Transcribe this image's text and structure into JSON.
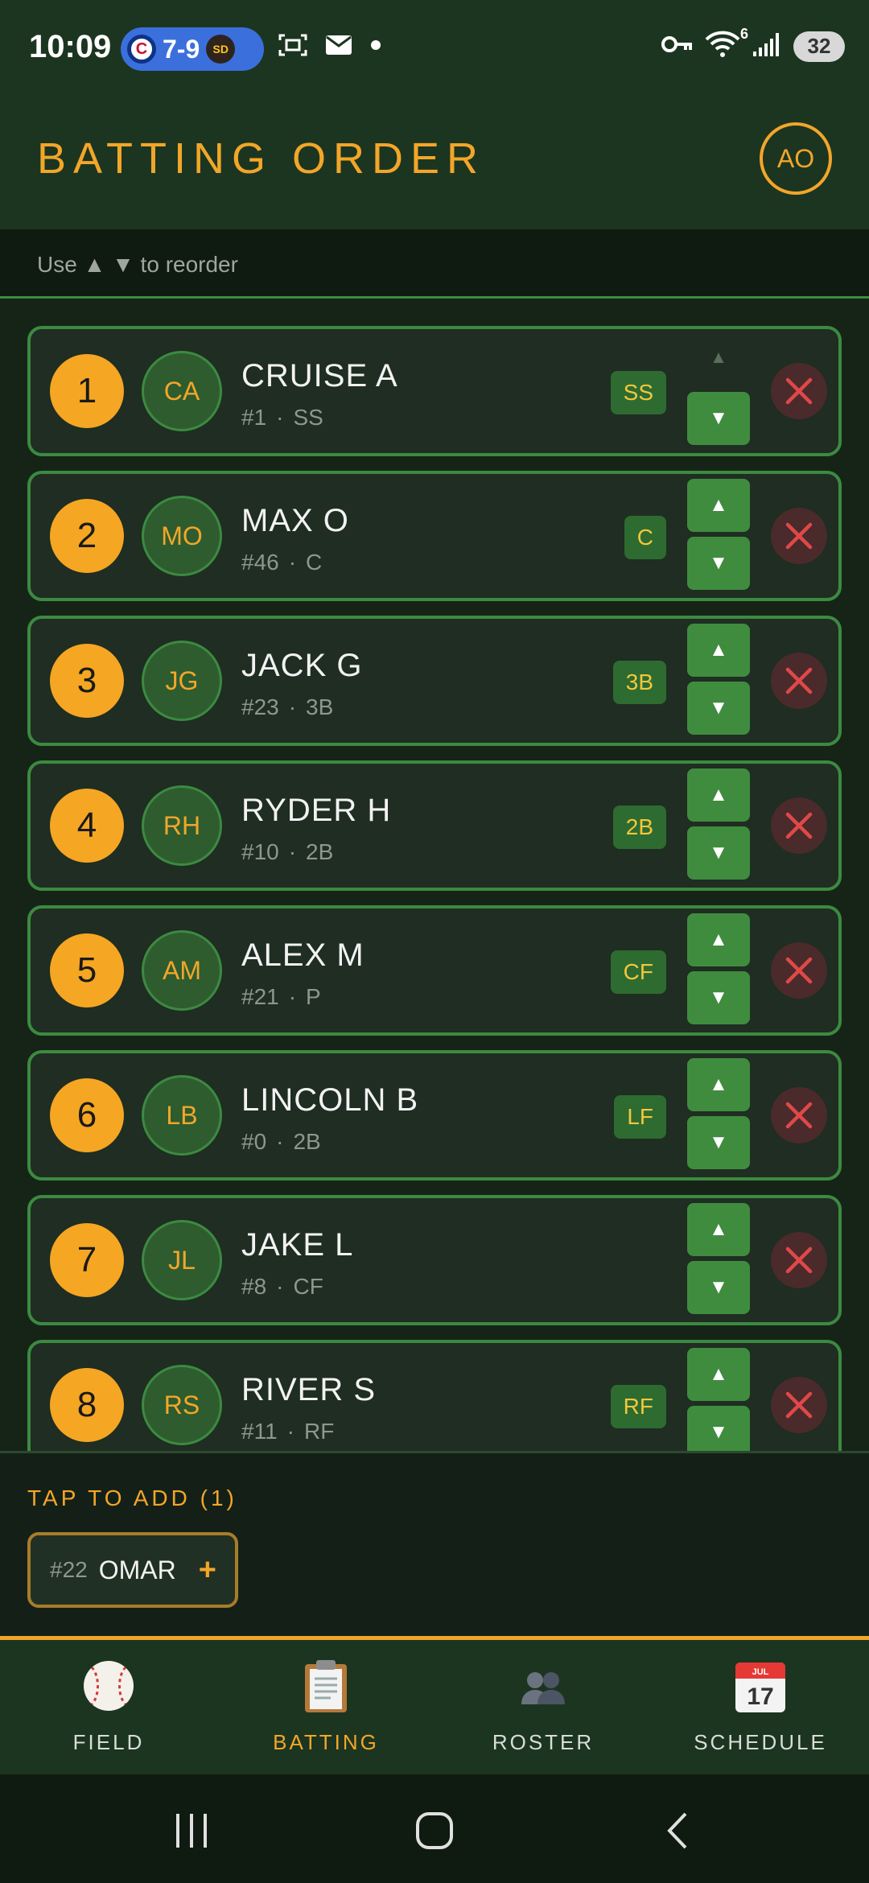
{
  "status_bar": {
    "time": "10:09",
    "score": "7-9",
    "away_team_badge": "C",
    "home_team_badge": "SD",
    "battery": "32",
    "network_label": "6"
  },
  "header": {
    "title": "BATTING ORDER",
    "user_initials": "AO"
  },
  "hint": "Use ▲ ▼ to reorder",
  "lineup": [
    {
      "order": "1",
      "initials": "CA",
      "name": "CRUISE A",
      "number": "#1",
      "primary_pos": "SS",
      "assigned_pos": "SS",
      "can_move_up": false
    },
    {
      "order": "2",
      "initials": "MO",
      "name": "MAX O",
      "number": "#46",
      "primary_pos": "C",
      "assigned_pos": "C",
      "can_move_up": true
    },
    {
      "order": "3",
      "initials": "JG",
      "name": "JACK G",
      "number": "#23",
      "primary_pos": "3B",
      "assigned_pos": "3B",
      "can_move_up": true
    },
    {
      "order": "4",
      "initials": "RH",
      "name": "RYDER H",
      "number": "#10",
      "primary_pos": "2B",
      "assigned_pos": "2B",
      "can_move_up": true
    },
    {
      "order": "5",
      "initials": "AM",
      "name": "ALEX M",
      "number": "#21",
      "primary_pos": "P",
      "assigned_pos": "CF",
      "can_move_up": true
    },
    {
      "order": "6",
      "initials": "LB",
      "name": "LINCOLN B",
      "number": "#0",
      "primary_pos": "2B",
      "assigned_pos": "LF",
      "can_move_up": true
    },
    {
      "order": "7",
      "initials": "JL",
      "name": "JAKE L",
      "number": "#8",
      "primary_pos": "CF",
      "assigned_pos": "",
      "can_move_up": true
    },
    {
      "order": "8",
      "initials": "RS",
      "name": "RIVER S",
      "number": "#11",
      "primary_pos": "RF",
      "assigned_pos": "RF",
      "can_move_up": true
    }
  ],
  "controls": {
    "up_glyph": "▲",
    "down_glyph": "▼",
    "separator": "·"
  },
  "add_section": {
    "title": "TAP TO ADD (1)",
    "bench": [
      {
        "number": "#22",
        "name": "OMAR",
        "add_glyph": "+"
      }
    ]
  },
  "bottom_nav": [
    {
      "label": "FIELD",
      "icon": "baseball-icon",
      "active": false
    },
    {
      "label": "BATTING",
      "icon": "clipboard-icon",
      "active": true
    },
    {
      "label": "ROSTER",
      "icon": "people-icon",
      "active": false
    },
    {
      "label": "SCHEDULE",
      "icon": "calendar-icon",
      "active": false
    }
  ],
  "calendar_icon_text": {
    "month": "JUL",
    "day": "17"
  },
  "colors": {
    "accent": "#f2a629",
    "green": "#3f8c3f",
    "background": "#162418",
    "header": "#1c3520"
  }
}
